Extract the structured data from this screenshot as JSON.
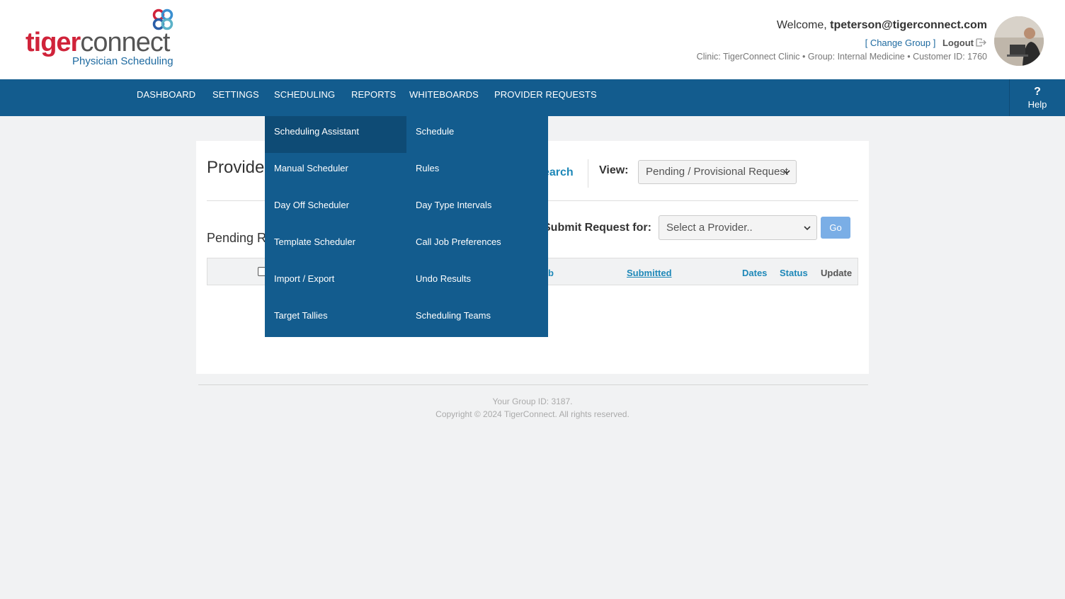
{
  "header": {
    "logo": {
      "word_a": "tiger",
      "word_b": "connect",
      "subtitle": "Physician Scheduling"
    },
    "welcome_prefix": "Welcome, ",
    "user_email": "tpeterson@tigerconnect.com",
    "change_group_label": "[ Change Group ]",
    "logout_label": "Logout",
    "meta": "Clinic: TigerConnect Clinic • Group: Internal Medicine • Customer ID: 1760"
  },
  "nav": {
    "items": [
      "DASHBOARD",
      "SETTINGS",
      "SCHEDULING",
      "REPORTS",
      "WHITEBOARDS",
      "PROVIDER REQUESTS"
    ],
    "help_symbol": "?",
    "help_label": "Help"
  },
  "dropdown": {
    "left_column": [
      "Scheduling Assistant",
      "Manual Scheduler",
      "Day Off Scheduler",
      "Template Scheduler",
      "Import / Export",
      "Target Tallies"
    ],
    "right_column": [
      "Schedule",
      "Rules",
      "Day Type Intervals",
      "Call Job Preferences",
      "Undo Results",
      "Scheduling Teams"
    ],
    "active_item": "Scheduling Assistant"
  },
  "main": {
    "page_title": "Provide",
    "search_link": "earch",
    "view_label": "View:",
    "view_select_value": "Pending / Provisional Request",
    "pending_title": "Pending R",
    "submit_label": "Submit Request for:",
    "provider_select_placeholder": "Select a Provider..",
    "go_label": "Go",
    "table_headers": {
      "job_partial": "b",
      "submitted": "Submitted",
      "dates": "Dates",
      "status": "Status",
      "update": "Update"
    }
  },
  "footer": {
    "group_id": "Your Group ID: 3187.",
    "copyright": "Copyright © 2024 TigerConnect. All rights reserved."
  },
  "colors": {
    "nav_bg": "#135c8e",
    "nav_active": "#0e4b75",
    "brand_red": "#d0233a",
    "link_blue": "#1e88b8",
    "go_button": "#7aaee6"
  }
}
